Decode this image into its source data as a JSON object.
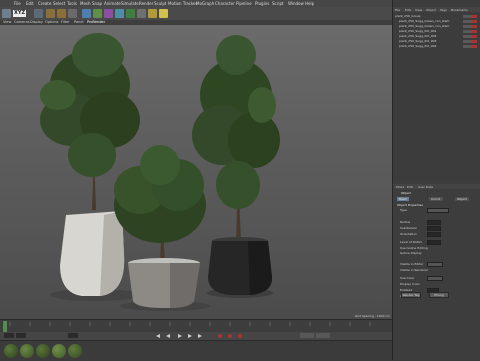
{
  "menubar": {
    "items": [
      "File",
      "Edit",
      "Create",
      "Select",
      "Tools",
      "Mesh",
      "Snap",
      "Animate",
      "Simulate",
      "Render",
      "Sculpt",
      "Motion Tracker",
      "MoGraph",
      "Character",
      "Pipeline",
      "Plugins",
      "Script",
      "Window",
      "Help"
    ]
  },
  "toolbar": {
    "xyz": "XYZ"
  },
  "viewport": {
    "menu": [
      "View",
      "Cameras",
      "Display",
      "Options",
      "Filter",
      "Panel",
      "ProRender"
    ],
    "status": "Grid Spacing : 1000 cm"
  },
  "objects": {
    "menu": [
      "File",
      "Edit",
      "View",
      "Object",
      "Tags",
      "Bookmarks"
    ],
    "rows": [
      "plant_250_Group",
      "plant_250_Sugg_Green_con_stem",
      "plant_250_Sugg_Green_con_stem",
      "plant_250_Sugg_Pot_001",
      "plant_250_Sugg_Pot_002",
      "plant_250_Sugg_Pot_003",
      "plant_250_Sugg_Pot_004"
    ]
  },
  "attributes": {
    "menu": [
      "Mode",
      "Edit",
      "User Data"
    ],
    "title": "Object",
    "tabs": [
      "Basic",
      "Coord.",
      "Object"
    ],
    "section": "Object Properties",
    "fields": [
      "Type",
      "Radius",
      "Subdivision",
      "Orientation",
      "Edit Mode",
      "Loop Subdivision",
      "Level of Detail",
      "Use Isoline Editing",
      "Isoline Display",
      "Visible in Editor",
      "Visible in Renderer",
      "Use Color",
      "Display Color",
      "Color",
      "Enabled",
      "X-Ray",
      "Active Object",
      "Layer"
    ],
    "buttons": [
      "Render Tag",
      "Phong"
    ]
  },
  "materials": {
    "colors": [
      "#2e3f1e",
      "#3a4d24",
      "#2f4220",
      "#415a2a",
      "#354a22"
    ]
  }
}
